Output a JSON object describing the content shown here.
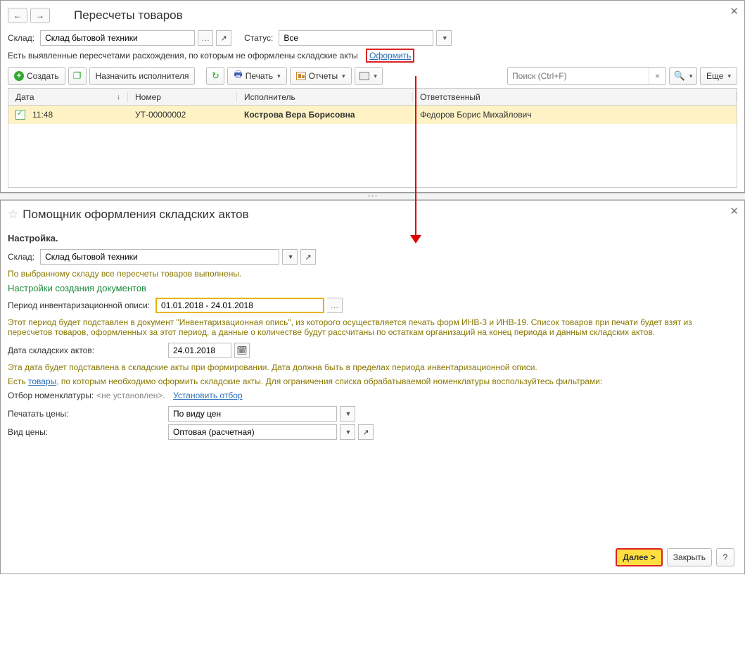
{
  "top": {
    "title": "Пересчеты товаров",
    "warehouse_label": "Склад:",
    "warehouse_value": "Склад бытовой техники",
    "status_label": "Статус:",
    "status_value": "Все",
    "info_text": "Есть выявленные пересчетами расхождения, по которым не оформлены складские акты",
    "link_oformit": "Оформить",
    "toolbar": {
      "create": "Создать",
      "assign": "Назначить исполнителя",
      "print": "Печать",
      "reports": "Отчеты",
      "more": "Еще"
    },
    "search_placeholder": "Поиск (Ctrl+F)",
    "table": {
      "col_date": "Дата",
      "col_number": "Номер",
      "col_executor": "Исполнитель",
      "col_responsible": "Ответственный",
      "row": {
        "time": "11:48",
        "number": "УТ-00000002",
        "executor": "Кострова Вера Борисовна",
        "responsible": "Федоров Борис Михайлович"
      }
    }
  },
  "bottom": {
    "title": "Помощник оформления складских актов",
    "settings_label": "Настройка.",
    "warehouse_label": "Склад:",
    "warehouse_value": "Склад бытовой техники",
    "msg_done": "По выбранному складу все пересчеты товаров выполнены.",
    "section_title": "Настройки создания документов",
    "period_label": "Период инвентаризационной описи:",
    "period_value": "01.01.2018 - 24.01.2018",
    "period_help": "Этот период будет подставлен в документ \"Инвентаризационная опись\", из которого осуществляется печать форм ИНВ-3 и ИНВ-19. Список товаров при печати будет взят из пересчетов товаров, оформленных за этот период, а данные о количестве будут рассчитаны по остаткам организаций на конец периода и данным складских актов.",
    "act_date_label": "Дата складских актов:",
    "act_date_value": "24.01.2018",
    "act_date_help": "Эта дата будет подставлена в складские акты при формировании. Дата должна быть в пределах периода инвентаризационной описи.",
    "goods_prefix": "Есть ",
    "goods_link": "товары",
    "goods_suffix": ", по которым необходимо оформить складские акты. Для ограничения списка обрабатываемой номенклатуры воспользуйтесь фильтрами:",
    "filter_label": "Отбор номенклатуры: ",
    "filter_value": "<не установлен>.",
    "filter_link": "Установить отбор",
    "print_prices_label": "Печатать цены:",
    "print_prices_value": "По виду цен",
    "price_type_label": "Вид цены:",
    "price_type_value": "Оптовая (расчетная)",
    "next_btn": "Далее >",
    "close_btn": "Закрыть",
    "help_btn": "?"
  }
}
